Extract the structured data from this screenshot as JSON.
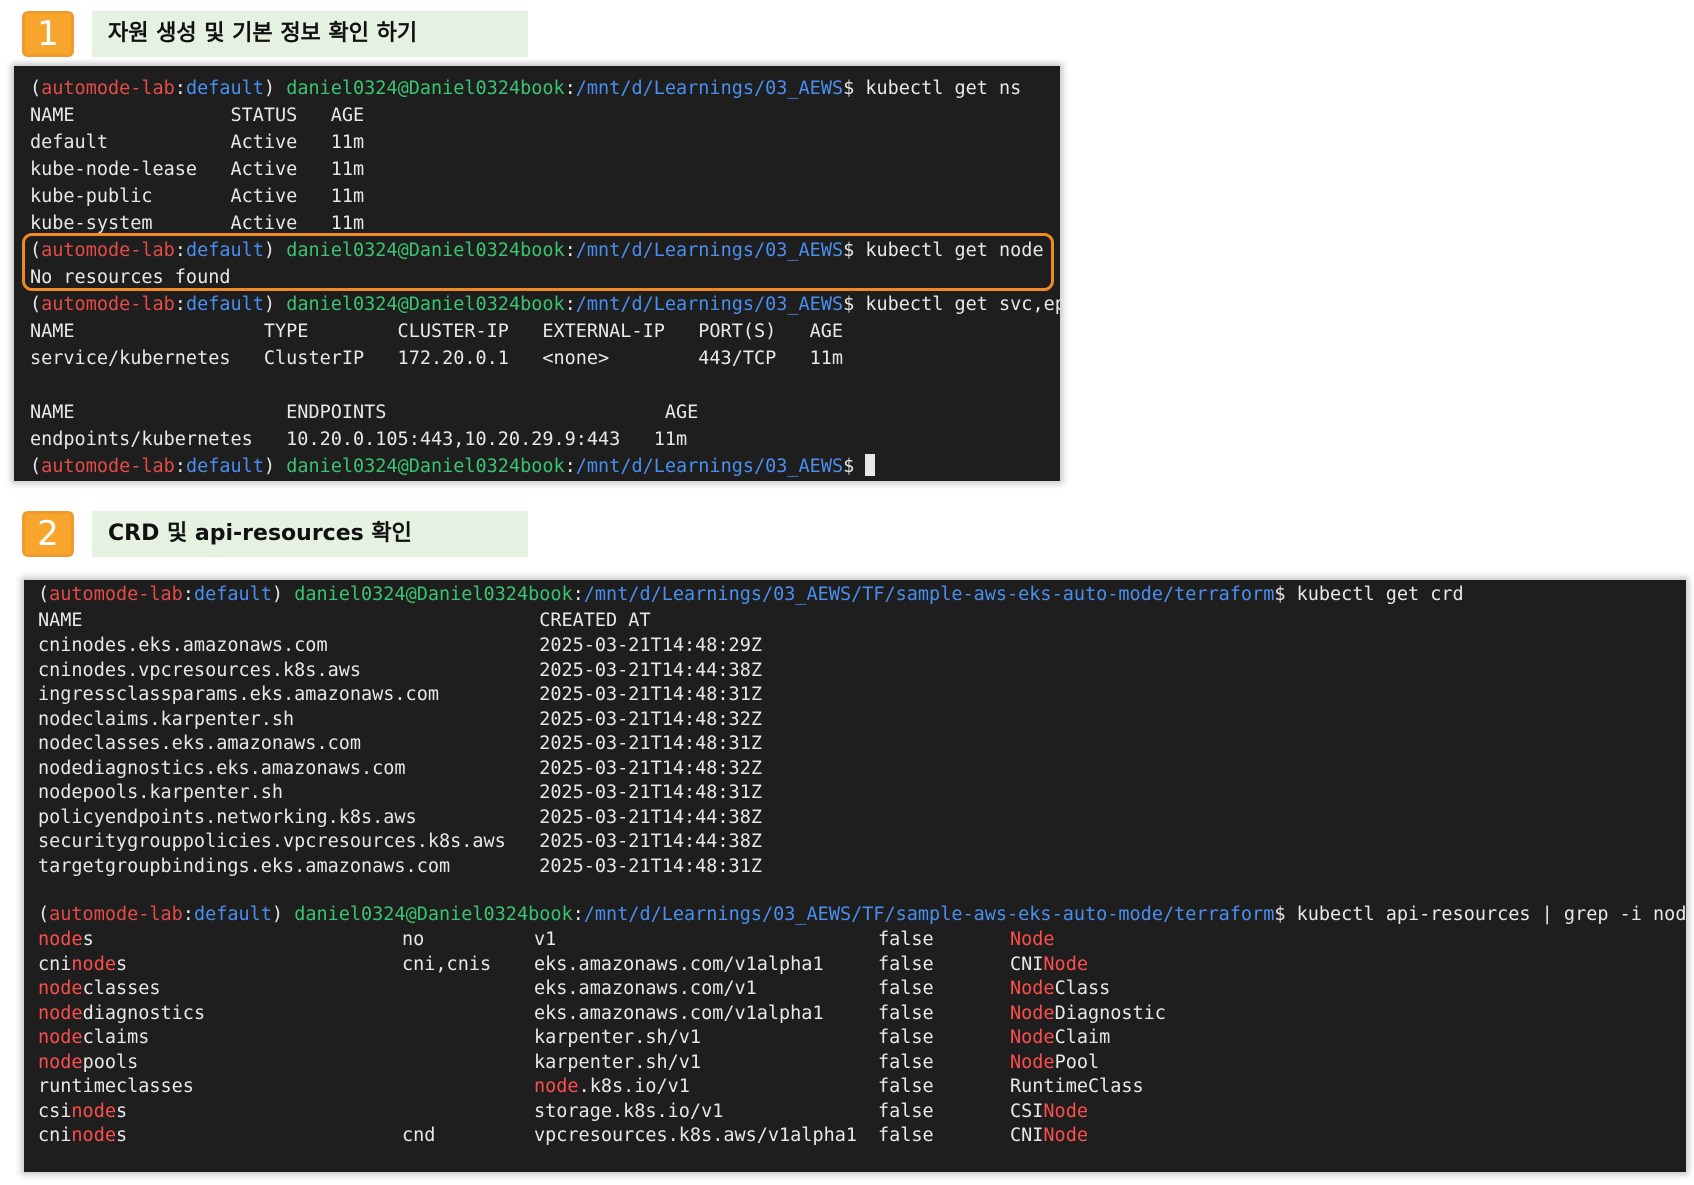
{
  "step1": {
    "number": "1",
    "title": "자원 생성 및 기본 정보 확인 하기"
  },
  "step2": {
    "number": "2",
    "title": "CRD 및 api-resources 확인"
  },
  "prompt": {
    "open": "(",
    "env": "automode-lab",
    "colon": ":",
    "ns": "default",
    "close": ") ",
    "user": "daniel0324@Daniel0324book",
    "path1": "/mnt/d/Learnings/03_AEWS",
    "path2": "/mnt/d/Learnings/03_AEWS/TF/sample-aws-eks-auto-mode/terraform",
    "dollar": "$ "
  },
  "term1": {
    "cmd1": "kubectl get ns",
    "ns_header": "NAME              STATUS   AGE",
    "ns_rows": [
      "default           Active   11m",
      "kube-node-lease   Active   11m",
      "kube-public       Active   11m",
      "kube-system       Active   11m"
    ],
    "cmd2": "kubectl get node",
    "node_result": "No resources found",
    "cmd3": "kubectl get svc,ep",
    "svc_header": "NAME                 TYPE        CLUSTER-IP   EXTERNAL-IP   PORT(S)   AGE",
    "svc_row": "service/kubernetes   ClusterIP   172.20.0.1   <none>        443/TCP   11m",
    "ep_header": "NAME                   ENDPOINTS                         AGE",
    "ep_row": "endpoints/kubernetes   10.20.0.105:443,10.20.29.9:443   11m"
  },
  "term2": {
    "cmd1": "kubectl get crd",
    "crd_header": "NAME                                         CREATED AT",
    "crd_rows": [
      "cninodes.eks.amazonaws.com                   2025-03-21T14:48:29Z",
      "cninodes.vpcresources.k8s.aws                2025-03-21T14:44:38Z",
      "ingressclassparams.eks.amazonaws.com         2025-03-21T14:48:31Z",
      "nodeclaims.karpenter.sh                      2025-03-21T14:48:32Z",
      "nodeclasses.eks.amazonaws.com                2025-03-21T14:48:31Z",
      "nodediagnostics.eks.amazonaws.com            2025-03-21T14:48:32Z",
      "nodepools.karpenter.sh                       2025-03-21T14:48:31Z",
      "policyendpoints.networking.k8s.aws           2025-03-21T14:44:38Z",
      "securitygrouppolicies.vpcresources.k8s.aws   2025-03-21T14:44:38Z",
      "targetgroupbindings.eks.amazonaws.com        2025-03-21T14:48:31Z"
    ],
    "cmd2": "kubectl api-resources | grep -i node",
    "api_rows": [
      {
        "name": [
          "",
          "node",
          "s"
        ],
        "short": "no",
        "ver": [
          "",
          "",
          "v1"
        ],
        "ns": "false",
        "kind": [
          "",
          "Node",
          ""
        ]
      },
      {
        "name": [
          "cni",
          "node",
          "s"
        ],
        "short": "cni,cnis",
        "ver": [
          "",
          "",
          "eks.amazonaws.com/v1alpha1"
        ],
        "ns": "false",
        "kind": [
          "CNI",
          "Node",
          ""
        ]
      },
      {
        "name": [
          "",
          "node",
          "classes"
        ],
        "short": "",
        "ver": [
          "",
          "",
          "eks.amazonaws.com/v1"
        ],
        "ns": "false",
        "kind": [
          "",
          "Node",
          "Class"
        ]
      },
      {
        "name": [
          "",
          "node",
          "diagnostics"
        ],
        "short": "",
        "ver": [
          "",
          "",
          "eks.amazonaws.com/v1alpha1"
        ],
        "ns": "false",
        "kind": [
          "",
          "Node",
          "Diagnostic"
        ]
      },
      {
        "name": [
          "",
          "node",
          "claims"
        ],
        "short": "",
        "ver": [
          "",
          "",
          "karpenter.sh/v1"
        ],
        "ns": "false",
        "kind": [
          "",
          "Node",
          "Claim"
        ]
      },
      {
        "name": [
          "",
          "node",
          "pools"
        ],
        "short": "",
        "ver": [
          "",
          "",
          "karpenter.sh/v1"
        ],
        "ns": "false",
        "kind": [
          "",
          "Node",
          "Pool"
        ]
      },
      {
        "name": [
          "runtimeclasses",
          "",
          ""
        ],
        "short": "",
        "ver": [
          "",
          "node",
          ".k8s.io/v1"
        ],
        "ns": "false",
        "kind": [
          "RuntimeClass",
          "",
          ""
        ]
      },
      {
        "name": [
          "csi",
          "node",
          "s"
        ],
        "short": "",
        "ver": [
          "",
          "",
          "storage.k8s.io/v1"
        ],
        "ns": "false",
        "kind": [
          "CSI",
          "Node",
          ""
        ]
      },
      {
        "name": [
          "cni",
          "node",
          "s"
        ],
        "short": "cnd",
        "ver": [
          "",
          "",
          "vpcresources.k8s.aws/v1alpha1"
        ],
        "ns": "false",
        "kind": [
          "CNI",
          "Node",
          ""
        ]
      }
    ]
  },
  "colors": {
    "prompt_env": "#e54c47",
    "prompt_ns": "#4a8ff0",
    "prompt_user": "#39c470",
    "grep_highlight": "#ff4d4d",
    "focus_box": "#f08a24",
    "step_badge": "#f7a52c",
    "step_title_bg": "#e6f2e1",
    "terminal_bg": "#1e1e1e"
  }
}
